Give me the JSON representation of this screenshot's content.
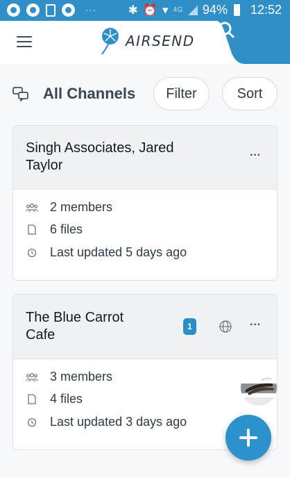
{
  "status_bar": {
    "battery": "94%",
    "time": "12:52",
    "network": "4G",
    "icons": [
      "chat-bubble-icon",
      "chat-bubble-icon",
      "gallery-icon",
      "chat-bubble-icon",
      "more-icon",
      "bluetooth-icon",
      "alarm-icon",
      "wifi-icon",
      "signal-icon",
      "battery-icon"
    ]
  },
  "header": {
    "app_name": "AIRSEND",
    "menu_icon": "hamburger-icon",
    "search_icon": "search-icon",
    "accent_color": "#2f8fc6"
  },
  "toolbar": {
    "title": "All Channels",
    "filter_label": "Filter",
    "sort_label": "Sort"
  },
  "channels": [
    {
      "title_line1": "Singh Associates, Jared",
      "title_line2": "Taylor",
      "members": "2 members",
      "files": "6 files",
      "updated": "Last updated 5 days ago"
    },
    {
      "title_line1": "The Blue Carrot",
      "title_line2": "Cafe",
      "badge": "1",
      "members": "3 members",
      "files": "4 files",
      "updated": "Last updated 3 days ago"
    }
  ]
}
